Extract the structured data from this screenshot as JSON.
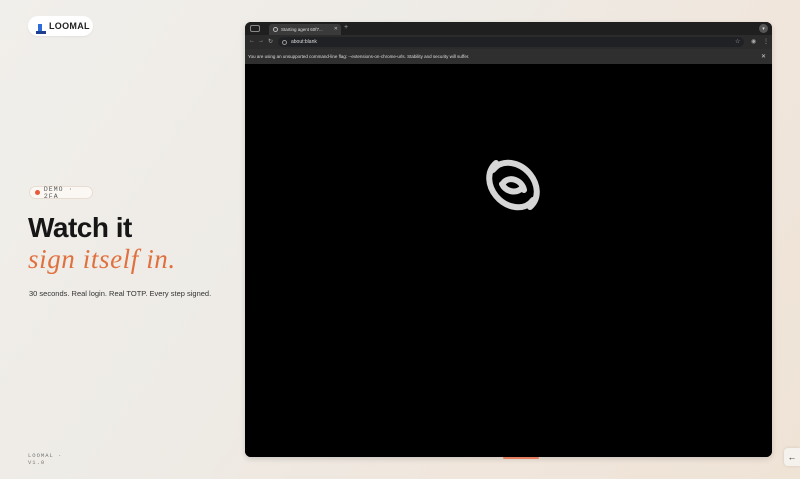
{
  "brand": {
    "name": "LOOMAL",
    "icon": "loomal-logo-icon"
  },
  "hero": {
    "badge": "DEMO · 2FA",
    "headline_1": "Watch it",
    "headline_2": "sign itself in.",
    "subline": "30 seconds. Real login. Real TOTP. Every step signed."
  },
  "footer": {
    "brand": "LOOMAL ·",
    "version": "V1.0"
  },
  "browser": {
    "tab_title": "Starting agent 60f7...",
    "address": "about:blank",
    "infobar": "You are using an unsupported command-line flag: --extensions-on-chrome-urls. Stability and security will suffer.",
    "icons": {
      "back": "back-arrow-icon",
      "forward": "forward-arrow-icon",
      "reload": "reload-icon",
      "star": "bookmark-star-icon",
      "menu": "kebab-menu-icon"
    }
  },
  "colors": {
    "accent": "#e0703e",
    "dot": "#e85a3a",
    "browser_bg": "#000000"
  }
}
